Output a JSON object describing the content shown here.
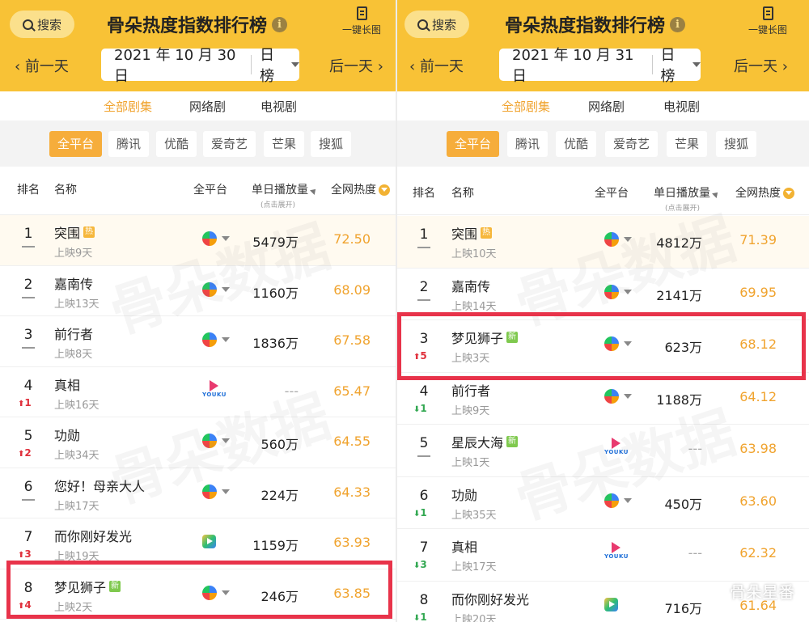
{
  "left": {
    "search_label": "搜索",
    "title": "骨朵热度指数排行榜",
    "info_glyph": "i",
    "long_image_label": "一键长图",
    "prev_label": "前一天",
    "next_label": "后一天",
    "date": "2021 年 10 月 30 日",
    "range": "日榜",
    "tabs": [
      "全部剧集",
      "网络剧",
      "电视剧"
    ],
    "platforms": [
      "全平台",
      "腾讯",
      "优酷",
      "爱奇艺",
      "芒果",
      "搜狐"
    ],
    "headers": {
      "rank": "排名",
      "name": "名称",
      "platform": "全平台",
      "plays": "单日播放量",
      "plays_note": "(点击展开)",
      "heat": "全网热度"
    },
    "rows": [
      {
        "rank": "1",
        "change": "",
        "dir": "",
        "name": "突围",
        "badge": "热",
        "badge_type": "hot",
        "sub": "上映9天",
        "platform": "all",
        "plays": "5479万",
        "heat": "72.50"
      },
      {
        "rank": "2",
        "change": "",
        "dir": "",
        "name": "嘉南传",
        "badge": "",
        "badge_type": "",
        "sub": "上映13天",
        "platform": "all",
        "plays": "1160万",
        "heat": "68.09"
      },
      {
        "rank": "3",
        "change": "",
        "dir": "",
        "name": "前行者",
        "badge": "",
        "badge_type": "",
        "sub": "上映8天",
        "platform": "all",
        "plays": "1836万",
        "heat": "67.58"
      },
      {
        "rank": "4",
        "change": "1",
        "dir": "up",
        "name": "真相",
        "badge": "",
        "badge_type": "",
        "sub": "上映16天",
        "platform": "youku",
        "plays": "---",
        "heat": "65.47"
      },
      {
        "rank": "5",
        "change": "2",
        "dir": "up",
        "name": "功勋",
        "badge": "",
        "badge_type": "",
        "sub": "上映34天",
        "platform": "all",
        "plays": "560万",
        "heat": "64.55"
      },
      {
        "rank": "6",
        "change": "",
        "dir": "",
        "name": "您好！母亲大人",
        "badge": "",
        "badge_type": "",
        "sub": "上映17天",
        "platform": "all",
        "plays": "224万",
        "heat": "64.33"
      },
      {
        "rank": "7",
        "change": "3",
        "dir": "up",
        "name": "而你刚好发光",
        "badge": "",
        "badge_type": "",
        "sub": "上映19天",
        "platform": "iqiyi",
        "plays": "1159万",
        "heat": "63.93"
      },
      {
        "rank": "8",
        "change": "4",
        "dir": "up",
        "name": "梦见狮子",
        "badge": "新",
        "badge_type": "new",
        "sub": "上映2天",
        "platform": "all",
        "plays": "246万",
        "heat": "63.85"
      }
    ],
    "youku_text": "YOUKU",
    "watermark": "骨朵数据"
  },
  "right": {
    "search_label": "搜索",
    "title": "骨朵热度指数排行榜",
    "info_glyph": "i",
    "long_image_label": "一键长图",
    "prev_label": "前一天",
    "next_label": "后一天",
    "date": "2021 年 10 月 31 日",
    "range": "日榜",
    "tabs": [
      "全部剧集",
      "网络剧",
      "电视剧"
    ],
    "platforms": [
      "全平台",
      "腾讯",
      "优酷",
      "爱奇艺",
      "芒果",
      "搜狐"
    ],
    "headers": {
      "rank": "排名",
      "name": "名称",
      "platform": "全平台",
      "plays": "单日播放量",
      "plays_note": "(点击展开)",
      "heat": "全网热度"
    },
    "rows": [
      {
        "rank": "1",
        "change": "",
        "dir": "",
        "name": "突围",
        "badge": "热",
        "badge_type": "hot",
        "sub": "上映10天",
        "platform": "all",
        "plays": "4812万",
        "heat": "71.39"
      },
      {
        "rank": "2",
        "change": "",
        "dir": "",
        "name": "嘉南传",
        "badge": "",
        "badge_type": "",
        "sub": "上映14天",
        "platform": "all",
        "plays": "2141万",
        "heat": "69.95"
      },
      {
        "rank": "3",
        "change": "5",
        "dir": "up",
        "name": "梦见狮子",
        "badge": "新",
        "badge_type": "new",
        "sub": "上映3天",
        "platform": "all",
        "plays": "623万",
        "heat": "68.12"
      },
      {
        "rank": "4",
        "change": "1",
        "dir": "down",
        "name": "前行者",
        "badge": "",
        "badge_type": "",
        "sub": "上映9天",
        "platform": "all",
        "plays": "1188万",
        "heat": "64.12"
      },
      {
        "rank": "5",
        "change": "",
        "dir": "",
        "name": "星辰大海",
        "badge": "新",
        "badge_type": "new",
        "sub": "上映1天",
        "platform": "youku",
        "plays": "---",
        "heat": "63.98"
      },
      {
        "rank": "6",
        "change": "1",
        "dir": "down",
        "name": "功勋",
        "badge": "",
        "badge_type": "",
        "sub": "上映35天",
        "platform": "all",
        "plays": "450万",
        "heat": "63.60"
      },
      {
        "rank": "7",
        "change": "3",
        "dir": "down",
        "name": "真相",
        "badge": "",
        "badge_type": "",
        "sub": "上映17天",
        "platform": "youku",
        "plays": "---",
        "heat": "62.32"
      },
      {
        "rank": "8",
        "change": "1",
        "dir": "down",
        "name": "而你刚好发光",
        "badge": "",
        "badge_type": "",
        "sub": "上映20天",
        "platform": "iqiyi",
        "plays": "716万",
        "heat": "61.64"
      }
    ],
    "youku_text": "YOUKU",
    "watermark": "骨朵数据"
  },
  "wechat_label": "骨朵星番",
  "colors": {
    "accent": "#f8c236",
    "heat": "#f0a32e",
    "up": "#e0303c",
    "down": "#33a852",
    "highlight": "#e8334a"
  }
}
